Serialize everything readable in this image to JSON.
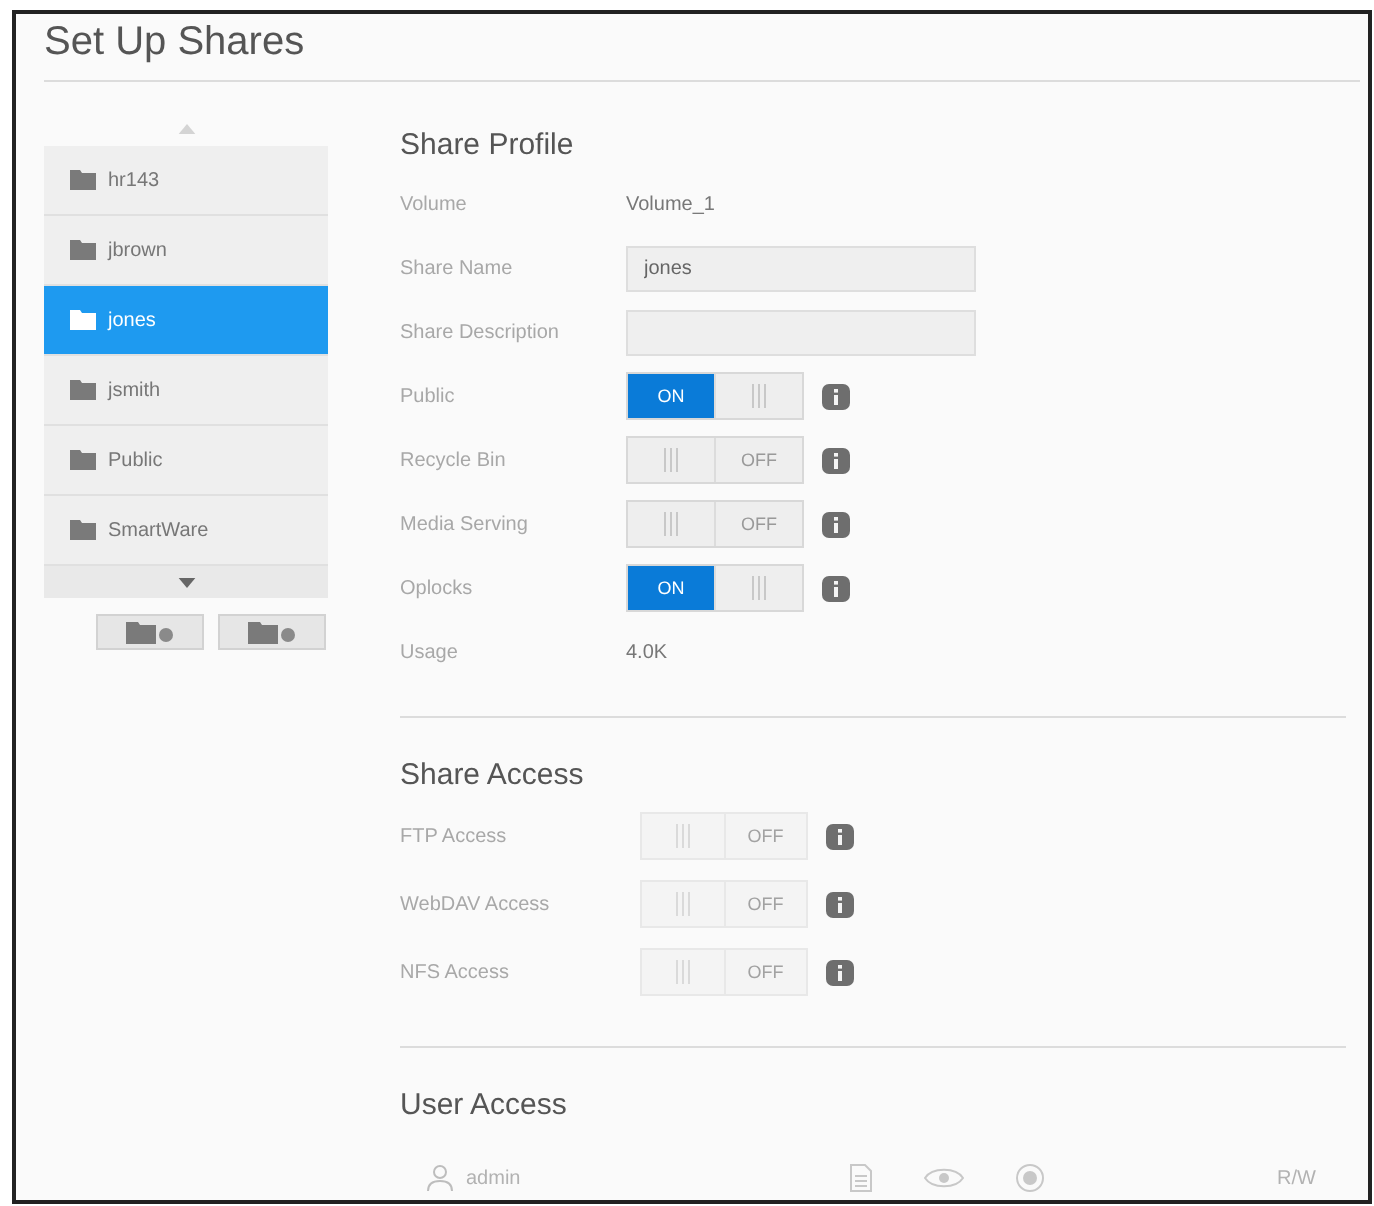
{
  "window": {
    "title": "Set Up Shares"
  },
  "share_list": {
    "scroll_up": {
      "disabled": true
    },
    "items": [
      {
        "name": "hr143",
        "selected": false
      },
      {
        "name": "jbrown",
        "selected": false
      },
      {
        "name": "jones",
        "selected": true
      },
      {
        "name": "jsmith",
        "selected": false
      },
      {
        "name": "Public",
        "selected": false
      },
      {
        "name": "SmartWare",
        "selected": false
      }
    ],
    "scroll_down": {
      "disabled": false
    }
  },
  "share_profile": {
    "title": "Share Profile",
    "rows": [
      {
        "kind": "text",
        "label": "Volume",
        "value": "Volume_1"
      },
      {
        "kind": "input",
        "label": "Share Name",
        "value": "jones"
      },
      {
        "kind": "input",
        "label": "Share Description"
      },
      {
        "kind": "toggle",
        "label": "Public",
        "on": true,
        "text": "ON",
        "disabled": false
      },
      {
        "kind": "toggle",
        "label": "Recycle Bin",
        "on": false,
        "text": "OFF",
        "disabled": false
      },
      {
        "kind": "toggle",
        "label": "Media Serving",
        "on": false,
        "text": "OFF",
        "disabled": false
      },
      {
        "kind": "toggle",
        "label": "Oplocks",
        "on": true,
        "text": "ON",
        "disabled": false
      },
      {
        "kind": "text",
        "label": "Usage",
        "value": "4.0K"
      }
    ]
  },
  "share_access": {
    "title": "Share Access",
    "rows": [
      {
        "kind": "toggle",
        "label": "FTP Access",
        "on": false,
        "text": "OFF",
        "disabled": true
      },
      {
        "kind": "toggle",
        "label": "WebDAV Access",
        "on": false,
        "text": "OFF",
        "disabled": true
      },
      {
        "kind": "toggle",
        "label": "NFS Access",
        "on": false,
        "text": "OFF",
        "disabled": true
      }
    ]
  },
  "user_access": {
    "title": "User Access",
    "users": [
      {
        "name": "admin",
        "access": "R/W"
      }
    ]
  }
}
